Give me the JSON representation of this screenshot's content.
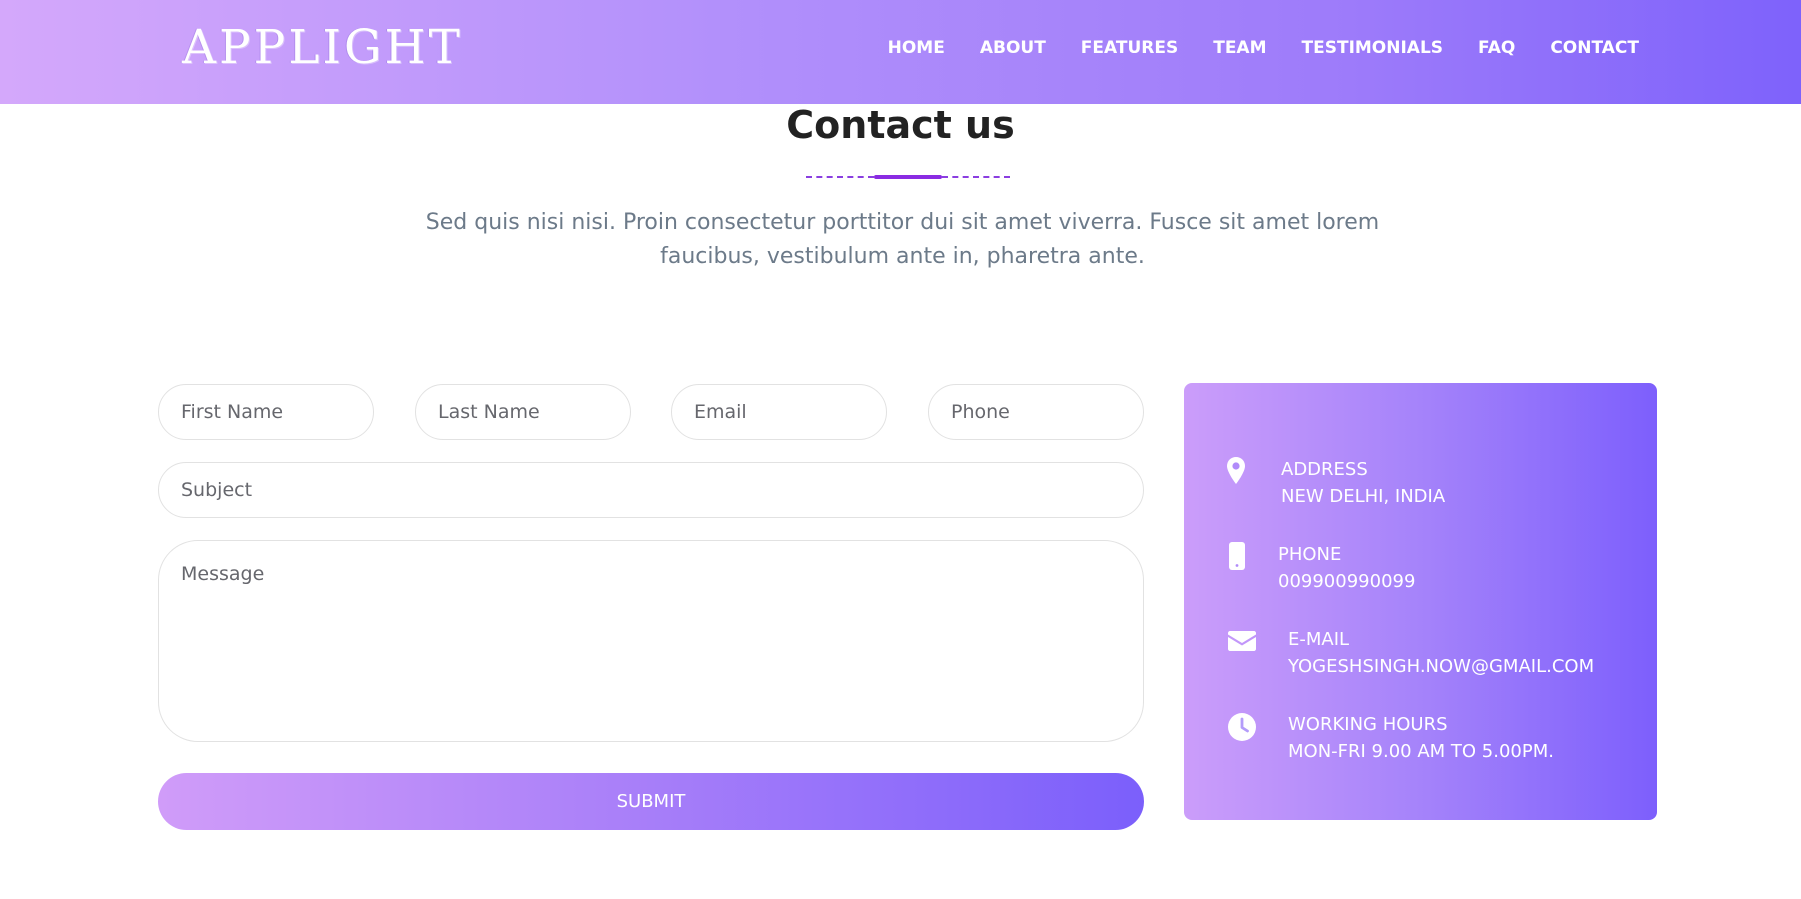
{
  "brand": {
    "logo": "APPLIGHT"
  },
  "nav": {
    "items": [
      "HOME",
      "ABOUT",
      "FEATURES",
      "TEAM",
      "TESTIMONIALS",
      "FAQ",
      "CONTACT"
    ]
  },
  "section": {
    "title": "Contact us",
    "description": "Sed quis nisi nisi. Proin consectetur porttitor dui sit amet viverra. Fusce sit amet lorem faucibus, vestibulum ante in, pharetra ante."
  },
  "form": {
    "first_name_placeholder": "First Name",
    "last_name_placeholder": "Last Name",
    "email_placeholder": "Email",
    "phone_placeholder": "Phone",
    "subject_placeholder": "Subject",
    "message_placeholder": "Message",
    "submit_label": "SUBMIT"
  },
  "contact_info": {
    "address": {
      "label": "ADDRESS",
      "value": "NEW DELHI, INDIA",
      "icon": "map-pin-icon"
    },
    "phone": {
      "label": "PHONE",
      "value": "009900990099",
      "icon": "mobile-phone-icon"
    },
    "email": {
      "label": "E-MAIL",
      "value": "YOGESHSINGH.NOW@GMAIL.COM",
      "icon": "envelope-icon"
    },
    "hours": {
      "label": "WORKING HOURS",
      "value": "MON-FRI 9.00 AM TO 5.00PM.",
      "icon": "clock-icon"
    }
  },
  "colors": {
    "header_gradient_start": "#d4a8fb",
    "header_gradient_end": "#7e62fb",
    "accent": "#8a2be2",
    "title_text": "#222222",
    "body_text": "#6c7a89"
  }
}
